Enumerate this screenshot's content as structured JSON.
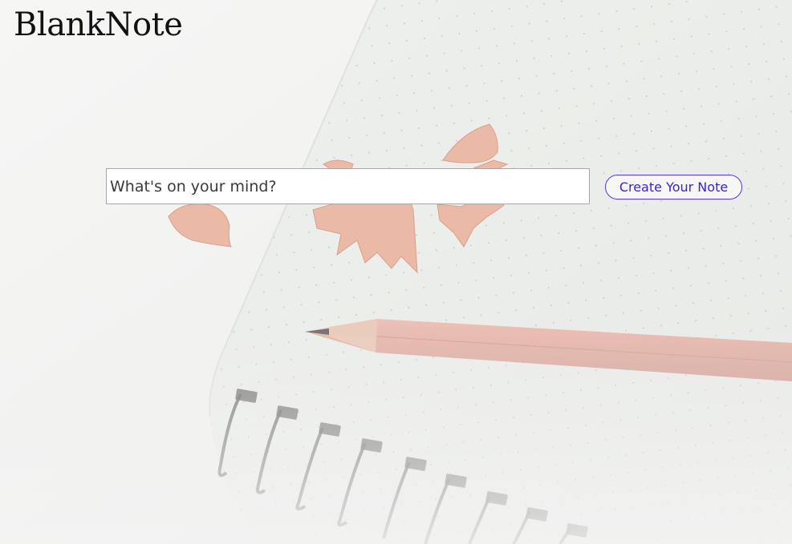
{
  "app": {
    "title": "BlankNote"
  },
  "note_form": {
    "input_value": "",
    "input_placeholder": "What's on your mind?",
    "create_button_label": "Create Your Note"
  },
  "colors": {
    "page_background": "#f1f2f0",
    "notebook_paper": "#eceeeb",
    "accent_button": "#5a36e0",
    "pencil_wood": "#e2b2a8",
    "shavings": "#eab8a4"
  },
  "background_image": {
    "subject": "spiral notebook with dotted paper, a pencil and pencil shavings"
  }
}
